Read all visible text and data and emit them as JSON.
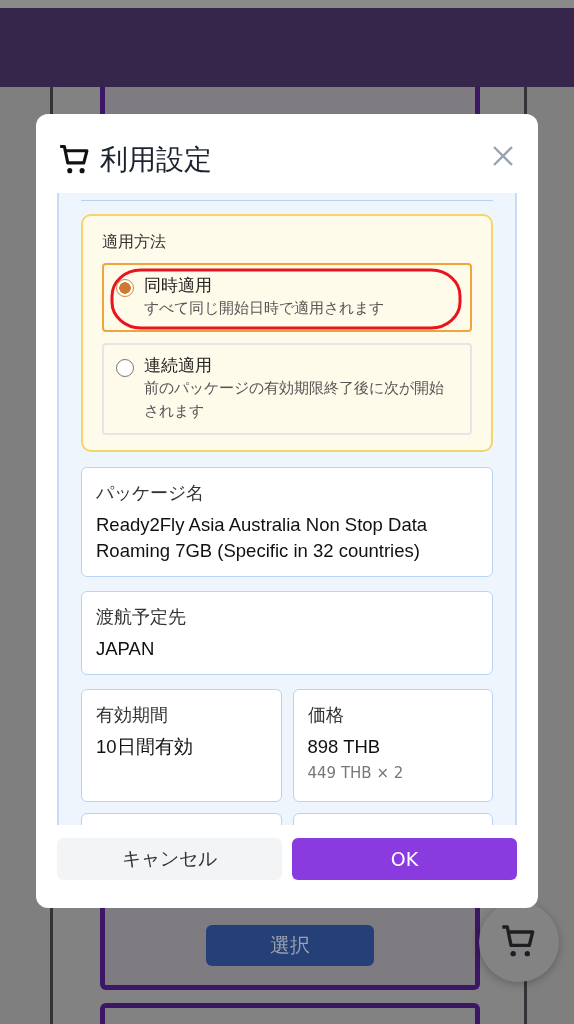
{
  "background": {
    "select_button": "選択"
  },
  "dialog": {
    "title": "利用設定",
    "apply_method": {
      "label": "適用方法",
      "options": [
        {
          "title": "同時適用",
          "description": "すべて同じ開始日時で適用されます",
          "selected": true,
          "annotated": true
        },
        {
          "title": "連続適用",
          "description": "前のパッケージの有効期限終了後に次が開始されます",
          "selected": false,
          "annotated": false
        }
      ]
    },
    "package": {
      "label": "パッケージ名",
      "value": "Ready2Fly Asia Australia Non Stop Data Roaming 7GB (Specific in 32 countries)"
    },
    "destination": {
      "label": "渡航予定先",
      "value": "JAPAN"
    },
    "validity": {
      "label": "有効期間",
      "value": "10日間有効"
    },
    "price": {
      "label": "価格",
      "value": "898 THB",
      "note": "449 THB × 2"
    },
    "cancel_button": "キャンセル",
    "ok_button": "OK"
  }
}
